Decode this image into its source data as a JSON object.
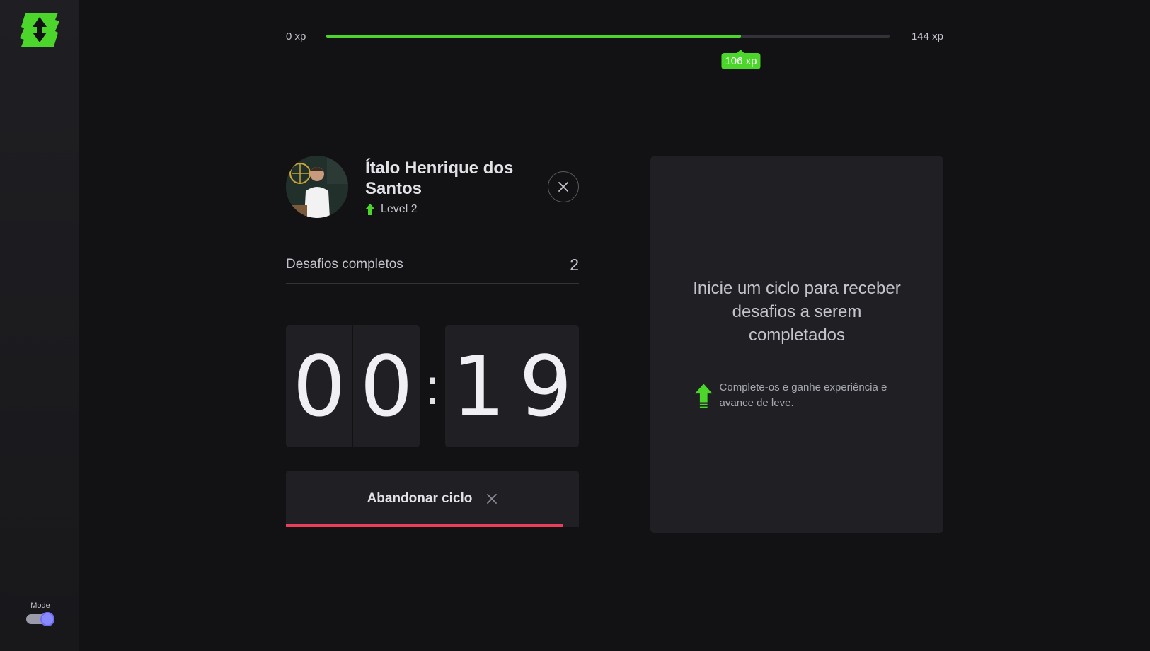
{
  "xp": {
    "min_label": "0 xp",
    "max_label": "144 xp",
    "current_label": "106 xp",
    "min": 0,
    "max": 144,
    "current": 106
  },
  "profile": {
    "name": "Ítalo Henrique dos Santos",
    "level_label": "Level 2"
  },
  "challenges": {
    "label": "Desafios completos",
    "count": "2"
  },
  "countdown": {
    "minutes": [
      "0",
      "0"
    ],
    "seconds": [
      "1",
      "9"
    ],
    "separator": ":"
  },
  "abandon": {
    "label": "Abandonar ciclo",
    "progress_fraction": 0.945
  },
  "card": {
    "title": "Inicie um ciclo para receber desafios a serem completados",
    "hint": "Complete-os e ganhe experiência e avance de leve."
  },
  "sidebar": {
    "mode_label": "Mode"
  },
  "colors": {
    "accent": "#4cd62b",
    "danger": "#e83f5b",
    "background": "#121214",
    "card": "#202024"
  }
}
